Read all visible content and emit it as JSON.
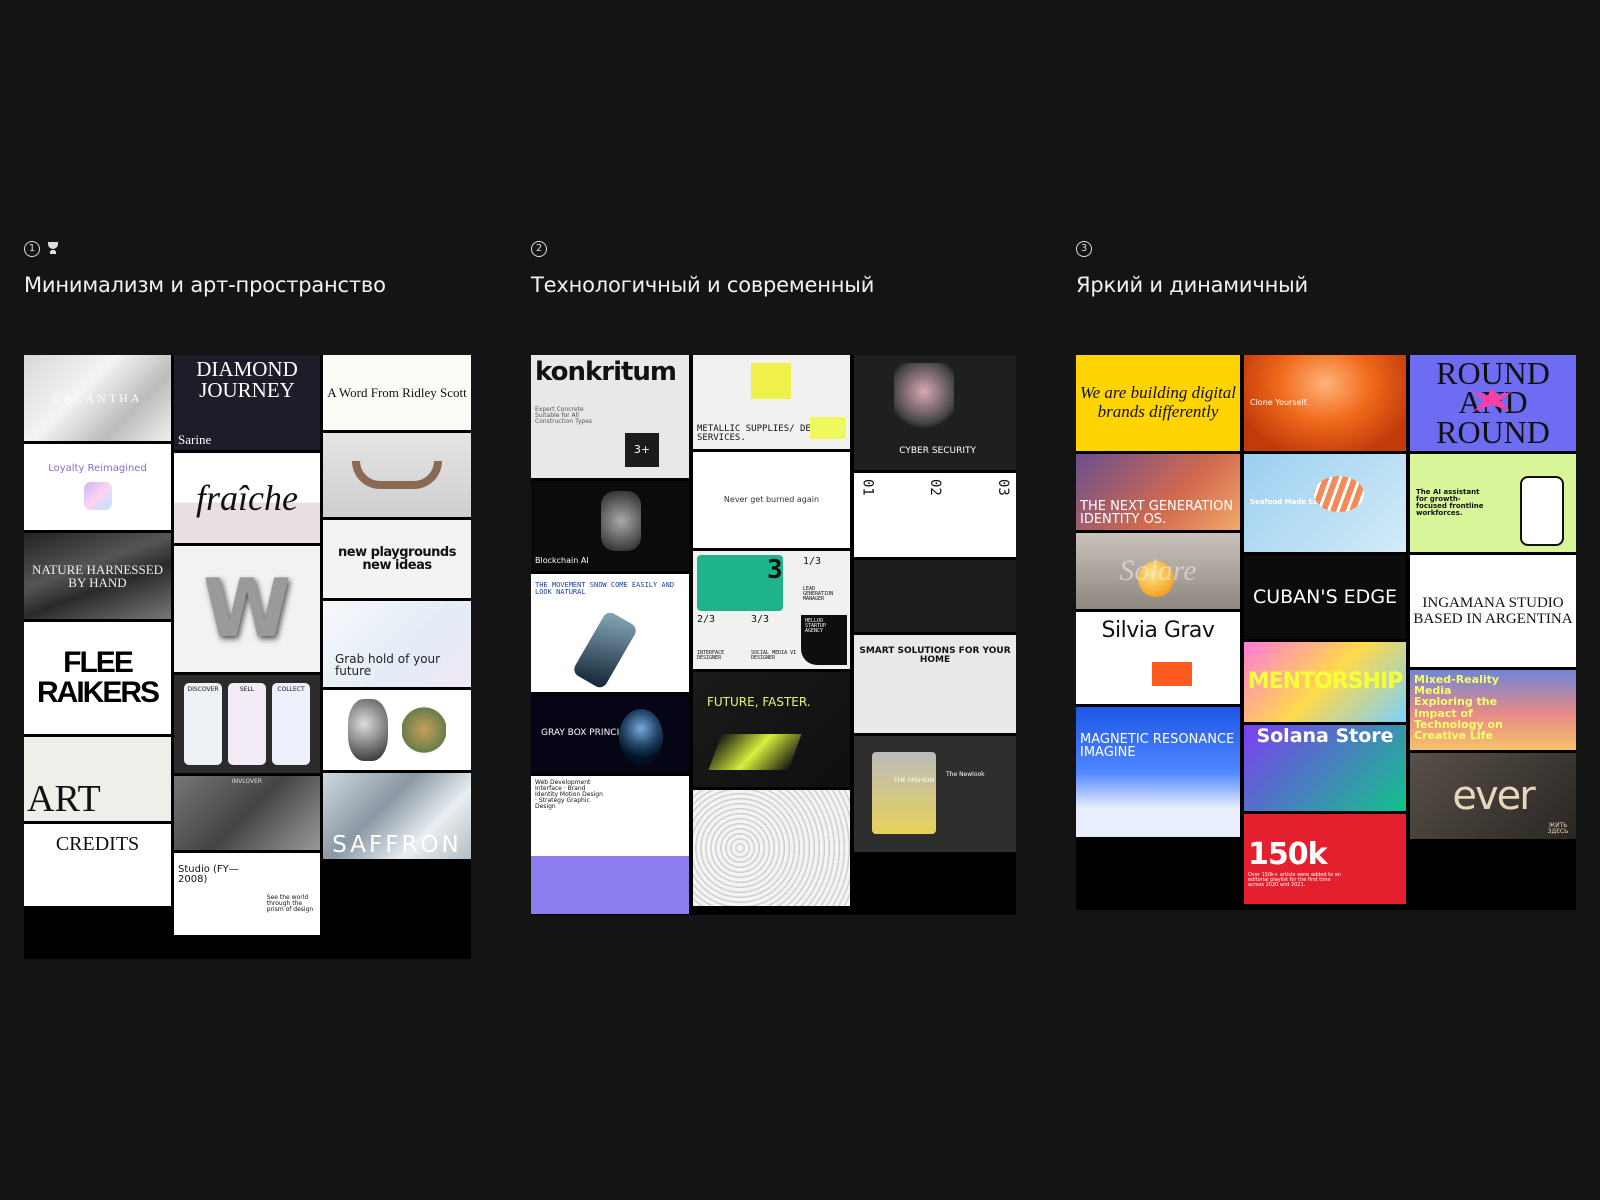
{
  "sections": [
    {
      "number": "1",
      "title": "Минимализм и арт-пространство"
    },
    {
      "number": "2",
      "title": "Технологичный и современный"
    },
    {
      "number": "3",
      "title": "Яркий и динамичный"
    }
  ],
  "board1": {
    "c1": [
      "CALANTHA",
      "Loyalty Reimagined",
      "NATURE HARNESSED BY HAND",
      "FLEE RAIKERS",
      "ART",
      "CREDITS"
    ],
    "c2": [
      "DIAMOND JOURNEY",
      "Sarine",
      "fraîche",
      "W",
      "DISCOVER",
      "SELL",
      "COLLECT",
      "INVLOVER",
      "Studio (FY—2008)",
      "See the world through the prism of design"
    ],
    "c3": [
      "A Word From Ridley Scott",
      "new playgrounds new ideas",
      "Grab hold of your future",
      "SAFFRON"
    ]
  },
  "board2": {
    "c1": [
      "konkritum",
      "Expert Concrete Suitable for All Construction Types",
      "3+",
      "Blockchain AI",
      "THE MOVEMENT SNOW COME EASILY AND LOOK NATURAL",
      "GRAY BOX PRINCIPLE",
      "Web Development Interface · Brand Identity Motion Design · Strategy Graphic Design"
    ],
    "c2": [
      "METALLIC SUPPLIES/ DELIVERY SERVICES.",
      "Never get burned again",
      "3",
      "1/3",
      "2/3",
      "3/3",
      "LEAD GENERATION MANAGER",
      "INTERFACE DESIGNER",
      "SOCIAL MEDIA VI DESIGNER",
      "HELLOO STARTUP AGENCY",
      "FUTURE, FASTER."
    ],
    "c3": [
      "CYBER SECURITY",
      "01",
      "02",
      "03",
      "SMART SOLUTIONS FOR YOUR HOME",
      "THE FASHION",
      "The Newlook"
    ]
  },
  "board3": {
    "c1": [
      "We are building digital brands differently",
      "THE NEXT GENERATION IDENTITY OS.",
      "Solare",
      "Silvia Grav",
      "MAGNETIC RESONANCE IMAGINE"
    ],
    "c2": [
      "Clone Yourself.",
      "Seafood Made Easily",
      "CUBAN'S EDGE",
      "MENTORSHIP",
      "Solana Store",
      "150k",
      "Over 150k+ artists were added to an editorial playlist for the first time across 2020 and 2021."
    ],
    "c3": [
      "ROUND AND ROUND",
      "The AI assistant for growth-focused frontline workforces.",
      "INGAMANA STUDIO BASED IN ARGENTINA",
      "Mixed-Reality Media Exploring the Impact of Technology on Creative Life",
      "ever",
      "ЖИТЬ ЗДЕСЬ"
    ]
  },
  "colors": {
    "background": "#141414",
    "board": "#000000"
  }
}
